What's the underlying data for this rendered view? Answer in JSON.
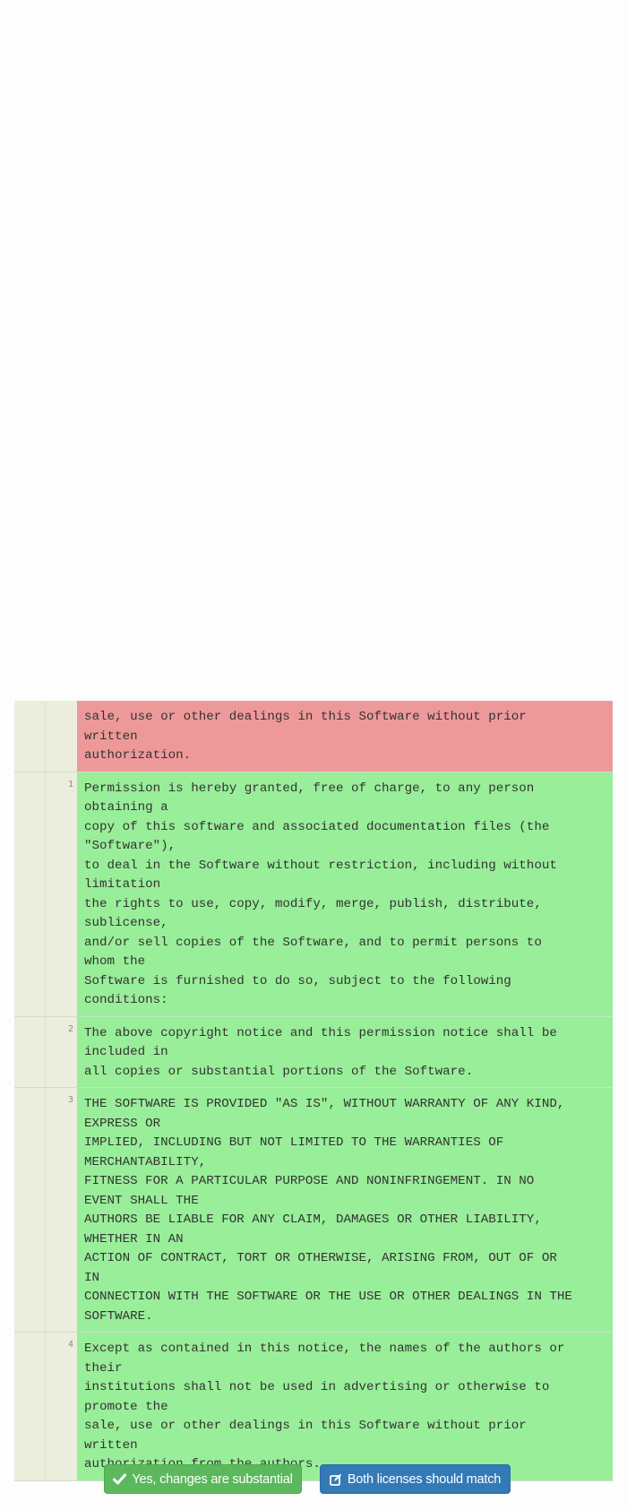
{
  "diff": {
    "rows": [
      {
        "type": "removed",
        "line_number": "",
        "text": "sale, use or other dealings in this Software without prior\nwritten\nauthorization."
      },
      {
        "type": "added",
        "line_number": "1",
        "text": "Permission is hereby granted, free of charge, to any person\nobtaining a\ncopy of this software and associated documentation files (the\n\"Software\"),\nto deal in the Software without restriction, including without\nlimitation\nthe rights to use, copy, modify, merge, publish, distribute,\nsublicense,\nand/or sell copies of the Software, and to permit persons to\nwhom the\nSoftware is furnished to do so, subject to the following\nconditions:"
      },
      {
        "type": "added",
        "line_number": "2",
        "text": "The above copyright notice and this permission notice shall be\nincluded in\nall copies or substantial portions of the Software."
      },
      {
        "type": "added",
        "line_number": "3",
        "text": "THE SOFTWARE IS PROVIDED \"AS IS\", WITHOUT WARRANTY OF ANY KIND,\nEXPRESS OR\nIMPLIED, INCLUDING BUT NOT LIMITED TO THE WARRANTIES OF\nMERCHANTABILITY,\nFITNESS FOR A PARTICULAR PURPOSE AND NONINFRINGEMENT. IN NO\nEVENT SHALL THE\nAUTHORS BE LIABLE FOR ANY CLAIM, DAMAGES OR OTHER LIABILITY,\nWHETHER IN AN\nACTION OF CONTRACT, TORT OR OTHERWISE, ARISING FROM, OUT OF OR\nIN\nCONNECTION WITH THE SOFTWARE OR THE USE OR OTHER DEALINGS IN THE\nSOFTWARE."
      },
      {
        "type": "added",
        "line_number": "4",
        "text": "Except as contained in this notice, the names of the authors or\ntheir\ninstitutions shall not be used in advertising or otherwise to\npromote the\nsale, use or other dealings in this Software without prior\nwritten\nauthorization from the authors."
      }
    ]
  },
  "actions": {
    "substantial_label": "Yes, changes are substantial",
    "substantial_icon": "check-icon",
    "match_label": "Both licenses should match",
    "match_icon": "edit-icon"
  },
  "colors": {
    "removed_bg": "#ee9999",
    "added_bg": "#99ee99",
    "gutter_bg": "#eceedd",
    "success": "#5cb85c",
    "primary": "#337ab7"
  }
}
